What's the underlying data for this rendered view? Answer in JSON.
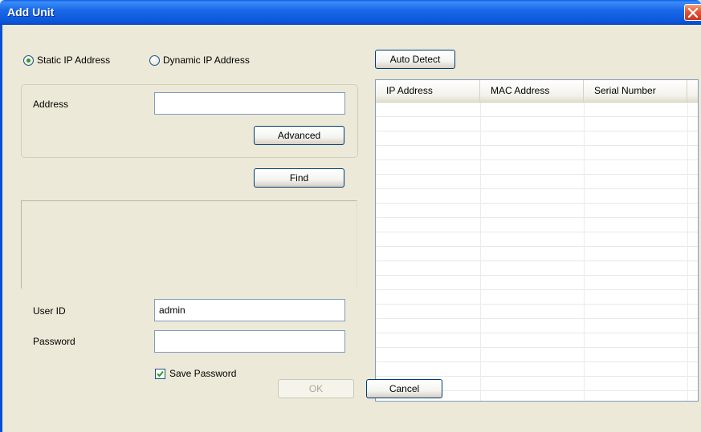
{
  "window": {
    "title": "Add Unit"
  },
  "address_mode": {
    "static_label": "Static IP Address",
    "dynamic_label": "Dynamic IP Address",
    "selected": "static"
  },
  "address_group": {
    "address_label": "Address",
    "address_value": "",
    "advanced_label": "Advanced"
  },
  "find_label": "Find",
  "credentials": {
    "user_id_label": "User ID",
    "user_id_value": "admin",
    "password_label": "Password",
    "password_value": "",
    "save_password_label": "Save Password",
    "save_password_checked": true
  },
  "auto_detect_label": "Auto Detect",
  "results_table": {
    "columns": [
      "IP Address",
      "MAC Address",
      "Serial Number"
    ],
    "rows": []
  },
  "footer": {
    "ok_label": "OK",
    "cancel_label": "Cancel"
  },
  "colors": {
    "title_bar": "#0c55d9",
    "dialog_bg": "#ece9d8",
    "check": "#2a9b27"
  }
}
